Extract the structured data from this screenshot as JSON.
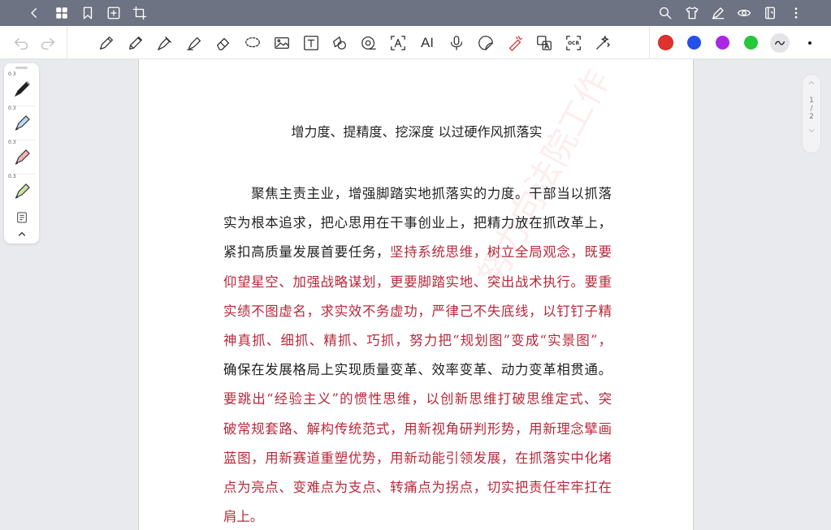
{
  "topbar": {
    "icons": [
      "back-icon",
      "grid-icon",
      "bookmark-icon",
      "add-page-icon",
      "crop-icon",
      "search-icon",
      "shirt-icon",
      "pen-edit-icon",
      "eye-icon",
      "notebook-icon",
      "more-icon"
    ]
  },
  "toolbar": {
    "tools": [
      "undo-icon",
      "redo-icon",
      "pen-icon",
      "pencil-icon",
      "fountain-pen-icon",
      "highlighter-icon",
      "eraser-icon",
      "lasso-icon",
      "image-icon",
      "text-box-icon",
      "shape-icon",
      "tape-icon",
      "text-recognition-icon",
      "ai-icon",
      "microphone-icon",
      "sticker-icon",
      "laser-pointer-icon",
      "translate-icon",
      "ocr-icon",
      "magic-icon"
    ],
    "ai_label": "AI",
    "ocr_label": "OCR",
    "colors": [
      "#e0332f",
      "#2450e8",
      "#a828e6",
      "#24c838"
    ]
  },
  "penbar": {
    "sizes": [
      "0.3",
      "0.3",
      "0.3",
      "0.3"
    ]
  },
  "document": {
    "title": "增力度、提精度、挖深度 以过硬作风抓落实",
    "lines": [
      {
        "segments": [
          {
            "text": "　　聚焦主责主业，增强脚踏实地抓落实的力度。干部当以抓落",
            "red": false
          }
        ]
      },
      {
        "segments": [
          {
            "text": "实为根本追求，把心思用在干事创业上，把精力放在抓改革上，",
            "red": false
          }
        ]
      },
      {
        "segments": [
          {
            "text": "紧扣高质量发展首要任务，",
            "red": false
          },
          {
            "text": "坚持系统思维，树立全局观念，既要",
            "red": true
          }
        ]
      },
      {
        "segments": [
          {
            "text": "仰望星空、加强战略谋划，更要脚踏实地、突出战术执行。要重",
            "red": true
          }
        ]
      },
      {
        "segments": [
          {
            "text": "实绩不图虚名，求实效不务虚功，严律己不失底线，以钉钉子精",
            "red": true
          }
        ]
      },
      {
        "segments": [
          {
            "text": "神真抓、细抓、精抓、巧抓，努力把“规划图”变成“实景图”，",
            "red": true
          }
        ]
      },
      {
        "segments": [
          {
            "text": "确保在发展格局上实现质量变革、效率变革、动力变革相贯通。",
            "red": false
          }
        ]
      },
      {
        "segments": [
          {
            "text": "要跳出“经验主义”的惯性思维，以创新思维打破思维定式、突",
            "red": true
          }
        ]
      },
      {
        "segments": [
          {
            "text": "破常规套路、解构传统范式，用新视角研判形势，用新理念擘画",
            "red": true
          }
        ]
      },
      {
        "segments": [
          {
            "text": "蓝图，用新赛道重塑优势，用新动能引领发展，在抓落实中化堵",
            "red": true
          }
        ]
      },
      {
        "segments": [
          {
            "text": "点为亮点、变难点为支点、转痛点为拐点，切实把责任牢牢扛在",
            "red": true
          }
        ]
      },
      {
        "segments": [
          {
            "text": "肩上。",
            "red": true
          }
        ]
      }
    ],
    "watermark": "努力向法院工作"
  },
  "pager": {
    "current": "1",
    "separator": "/",
    "total": "2"
  }
}
